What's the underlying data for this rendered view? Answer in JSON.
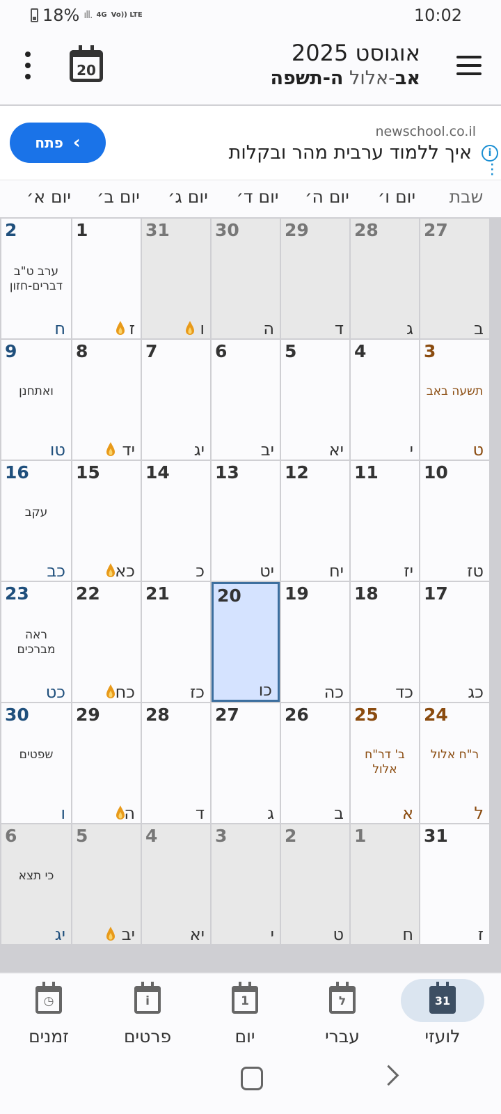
{
  "status_bar": {
    "battery": "18%",
    "network": [
      "4G",
      "Vo)) LTE"
    ],
    "time": "10:02"
  },
  "header": {
    "title": "אוגוסט 2025",
    "subtitle_bold_1": "אב",
    "subtitle_light": "-אלול ",
    "subtitle_bold_2": "ה-תשפה",
    "today_icon_day": "20"
  },
  "ad": {
    "domain": "newschool.co.il",
    "headline": "איך ללמוד ערבית מהר ובקלות",
    "button_label": "פתח"
  },
  "weekdays": [
    "שבת",
    "יום ו׳",
    "יום ה׳",
    "יום ד׳",
    "יום ג׳",
    "יום ב׳",
    "יום א׳"
  ],
  "weeks": [
    [
      {
        "g": "27",
        "h": "ב",
        "out": true
      },
      {
        "g": "28",
        "h": "ג",
        "out": true
      },
      {
        "g": "29",
        "h": "ד",
        "out": true
      },
      {
        "g": "30",
        "h": "ה",
        "out": true
      },
      {
        "g": "31",
        "h": "ו",
        "out": true,
        "candle": true
      },
      {
        "g": "1",
        "h": "ז",
        "candle": true
      },
      {
        "g": "2",
        "h": "ח",
        "shabbat": true,
        "event": "ערב ט\"ב\nדברים-חזון"
      }
    ],
    [
      {
        "g": "3",
        "h": "ט",
        "holiday": true,
        "event": "תשעה באב"
      },
      {
        "g": "4",
        "h": "י"
      },
      {
        "g": "5",
        "h": "יא"
      },
      {
        "g": "6",
        "h": "יב"
      },
      {
        "g": "7",
        "h": "יג"
      },
      {
        "g": "8",
        "h": "יד",
        "candle": true
      },
      {
        "g": "9",
        "h": "טו",
        "shabbat": true,
        "event": "ואתחנן"
      }
    ],
    [
      {
        "g": "10",
        "h": "טז"
      },
      {
        "g": "11",
        "h": "יז"
      },
      {
        "g": "12",
        "h": "יח"
      },
      {
        "g": "13",
        "h": "יט"
      },
      {
        "g": "14",
        "h": "כ"
      },
      {
        "g": "15",
        "h": "כא",
        "candle": true
      },
      {
        "g": "16",
        "h": "כב",
        "shabbat": true,
        "event": "עקב"
      }
    ],
    [
      {
        "g": "17",
        "h": "כג"
      },
      {
        "g": "18",
        "h": "כד"
      },
      {
        "g": "19",
        "h": "כה"
      },
      {
        "g": "20",
        "h": "כו",
        "selected": true
      },
      {
        "g": "21",
        "h": "כז"
      },
      {
        "g": "22",
        "h": "כח",
        "candle": true
      },
      {
        "g": "23",
        "h": "כט",
        "shabbat": true,
        "event": "ראה\nמברכים"
      }
    ],
    [
      {
        "g": "24",
        "h": "ל",
        "holiday": true,
        "event": "ר\"ח אלול"
      },
      {
        "g": "25",
        "h": "א",
        "holiday": true,
        "event": "ב' דר\"ח אלול"
      },
      {
        "g": "26",
        "h": "ב"
      },
      {
        "g": "27",
        "h": "ג"
      },
      {
        "g": "28",
        "h": "ד"
      },
      {
        "g": "29",
        "h": "ה",
        "candle": true
      },
      {
        "g": "30",
        "h": "ו",
        "shabbat": true,
        "event": "שפטים"
      }
    ],
    [
      {
        "g": "31",
        "h": "ז"
      },
      {
        "g": "1",
        "h": "ח",
        "out": true
      },
      {
        "g": "2",
        "h": "ט",
        "out": true
      },
      {
        "g": "3",
        "h": "י",
        "out": true
      },
      {
        "g": "4",
        "h": "יא",
        "out": true
      },
      {
        "g": "5",
        "h": "יב",
        "out": true,
        "candle": true
      },
      {
        "g": "6",
        "h": "יג",
        "out": true,
        "shabbat": true,
        "event": "כי תצא"
      }
    ]
  ],
  "bottom_nav": [
    {
      "label": "לועזי",
      "icon": "gregorian-calendar-icon",
      "glyph": "31",
      "active": true
    },
    {
      "label": "עברי",
      "icon": "hebrew-calendar-icon",
      "glyph": "ל"
    },
    {
      "label": "יום",
      "icon": "day-view-icon",
      "glyph": "1"
    },
    {
      "label": "פרטים",
      "icon": "details-icon",
      "glyph": "i"
    },
    {
      "label": "זמנים",
      "icon": "times-icon",
      "glyph": "◷"
    }
  ]
}
